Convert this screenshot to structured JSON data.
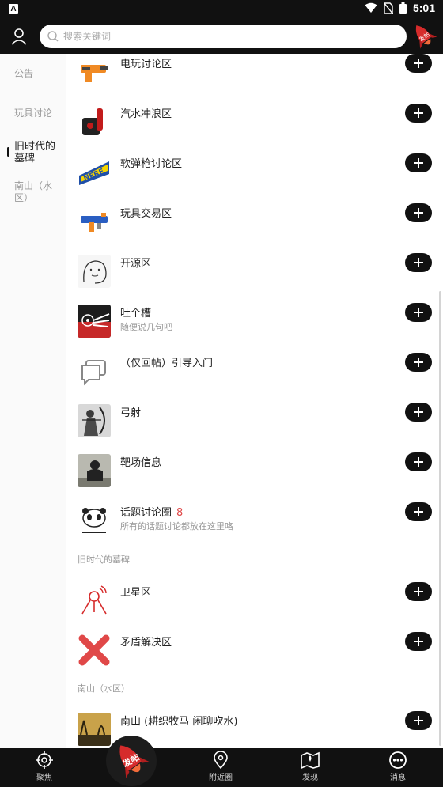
{
  "status_bar": {
    "time": "5:01",
    "badge": "A"
  },
  "search": {
    "placeholder": "搜索关键词"
  },
  "rocket_label": "发帖",
  "sidebar": {
    "items": [
      {
        "label": "公告"
      },
      {
        "label": "玩具讨论"
      },
      {
        "label": "旧时代的墓碑"
      },
      {
        "label": "南山（水区）"
      }
    ]
  },
  "list": {
    "rows": [
      {
        "title": "电玩讨论区",
        "subtitle": "",
        "icon": "toy-gun-icon"
      },
      {
        "title": "汽水冲浪区",
        "subtitle": "",
        "icon": "soda-icon"
      },
      {
        "title": "软弹枪讨论区",
        "subtitle": "",
        "icon": "nerf-logo-icon"
      },
      {
        "title": "玩具交易区",
        "subtitle": "",
        "icon": "blaster-icon"
      },
      {
        "title": "开源区",
        "subtitle": "",
        "icon": "sketch-face-icon"
      },
      {
        "title": "吐个槽",
        "subtitle": "随便说几句吧",
        "icon": "wing-target-icon"
      },
      {
        "title": "（仅回帖）引导入门",
        "subtitle": "",
        "icon": "chat-bubbles-icon"
      },
      {
        "title": "弓射",
        "subtitle": "",
        "icon": "archer-icon"
      },
      {
        "title": "靶场信息",
        "subtitle": "",
        "icon": "target-board-icon"
      },
      {
        "title": "话题讨论圈",
        "count": "8",
        "subtitle": "所有的话题讨论都放在这里咯",
        "icon": "panda-meme-icon"
      },
      {
        "title": "卫星区",
        "subtitle": "",
        "icon": "satellite-icon"
      },
      {
        "title": "矛盾解决区",
        "subtitle": "",
        "icon": "red-x-icon"
      },
      {
        "title": "南山 (耕织牧马 闲聊吹水)",
        "subtitle": "",
        "icon": "sunset-tree-icon"
      }
    ],
    "sections": [
      {
        "label": "旧时代的墓碑"
      },
      {
        "label": "南山（水区）"
      }
    ]
  },
  "bottom_nav": {
    "items": [
      {
        "label": "聚焦",
        "icon": "crosshair-icon"
      },
      {
        "label": "附近圈",
        "icon": "location-pin-icon"
      },
      {
        "label": "发现",
        "icon": "map-icon"
      },
      {
        "label": "消息",
        "icon": "message-icon"
      }
    ],
    "post_label": "发帖"
  },
  "colors": {
    "bar": "#111111",
    "accent_red": "#e04848",
    "rocket_red": "#d62b2b"
  }
}
